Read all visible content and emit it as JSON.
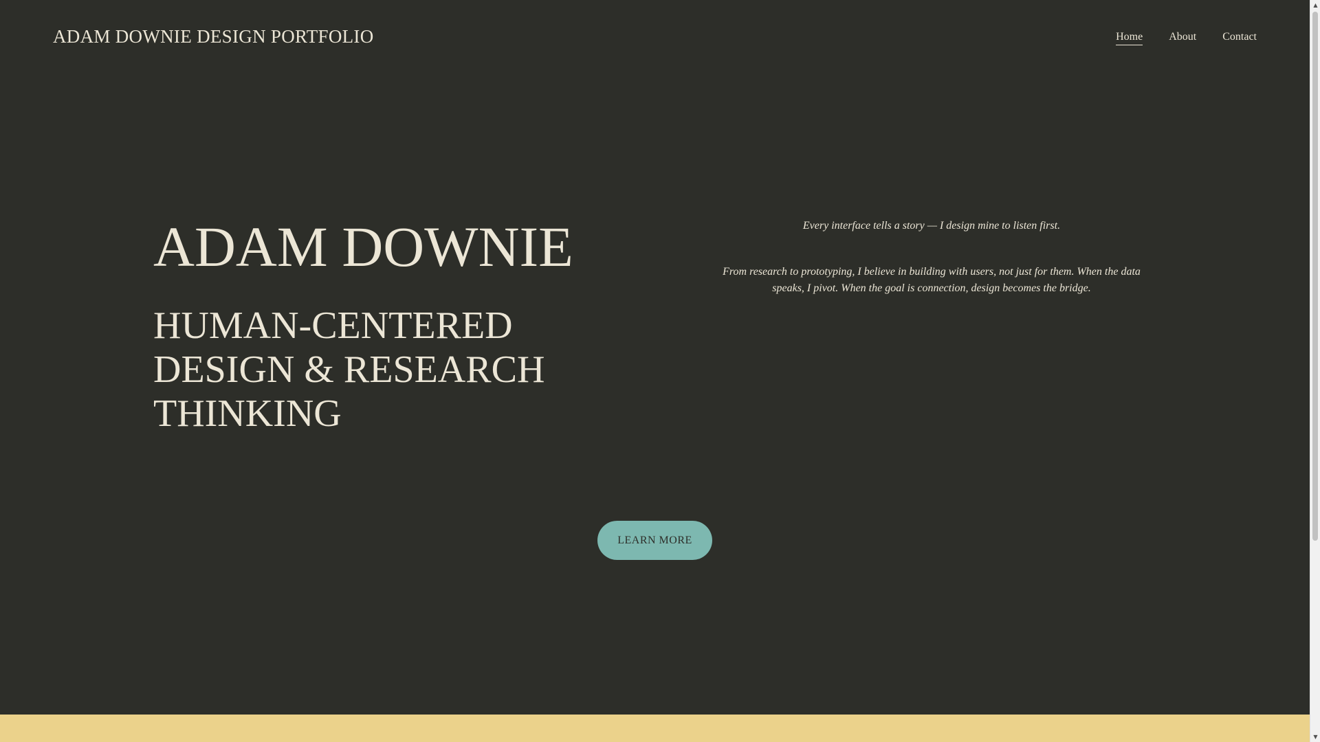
{
  "header": {
    "site_title": "ADAM DOWNIE DESIGN PORTFOLIO",
    "nav": [
      {
        "label": "Home",
        "active": true
      },
      {
        "label": "About",
        "active": false
      },
      {
        "label": "Contact",
        "active": false
      }
    ]
  },
  "hero": {
    "name": "ADAM DOWNIE",
    "tagline": "HUMAN-CENTERED DESIGN & RESEARCH THINKING",
    "quote": "Every interface tells a story — I design mine to listen first.",
    "intro": "From research to prototyping, I believe in building with users, not just for them. When the data speaks, I pivot. When the goal is connection, design becomes the bridge.",
    "cta_label": "LEARN MORE"
  },
  "colors": {
    "background": "#2d2e29",
    "text": "#ece6d6",
    "accent_button": "#7db8b0",
    "bottom_band": "#ebd28b"
  },
  "scrollbar": {
    "up_icon": "triangle-up-icon",
    "down_icon": "triangle-down-icon"
  }
}
